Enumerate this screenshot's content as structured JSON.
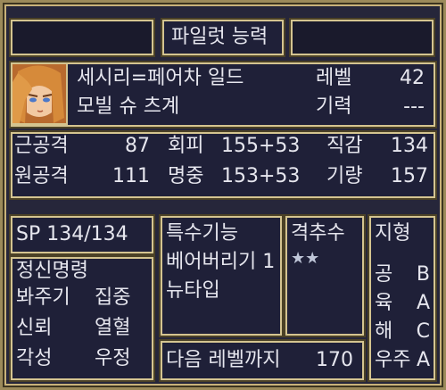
{
  "header": {
    "title": "파일럿 능력"
  },
  "pilot": {
    "name": "세시리=페어차 일드",
    "title": "모빌 슈 츠계",
    "level_label": "레벨",
    "level_value": "42",
    "energy_label": "기력",
    "energy_value": "---"
  },
  "stats": [
    {
      "label": "근공격",
      "value": "87"
    },
    {
      "label": "회피",
      "value": "155+53"
    },
    {
      "label": "직감",
      "value": "134"
    },
    {
      "label": "원공격",
      "value": "111"
    },
    {
      "label": "명중",
      "value": "153+53"
    },
    {
      "label": "기량",
      "value": "157"
    }
  ],
  "sp": {
    "text": "SP 134/134"
  },
  "spirit": {
    "title": "정신명령",
    "items": [
      "봐주기",
      "집중",
      "신뢰",
      "열혈",
      "각성",
      "우정"
    ]
  },
  "special": {
    "title": "특수기능",
    "items": [
      "베어버리기 1",
      "뉴타입"
    ]
  },
  "counter": {
    "title": "격추수",
    "stars": "★★"
  },
  "next_level": {
    "label": "다음 레벨까지",
    "value": "170"
  },
  "terrain": {
    "title": "지형",
    "items": [
      {
        "label": "공",
        "grade": "B"
      },
      {
        "label": "육",
        "grade": "A"
      },
      {
        "label": "해",
        "grade": "C"
      },
      {
        "label": "우주",
        "grade": "A"
      }
    ]
  }
}
